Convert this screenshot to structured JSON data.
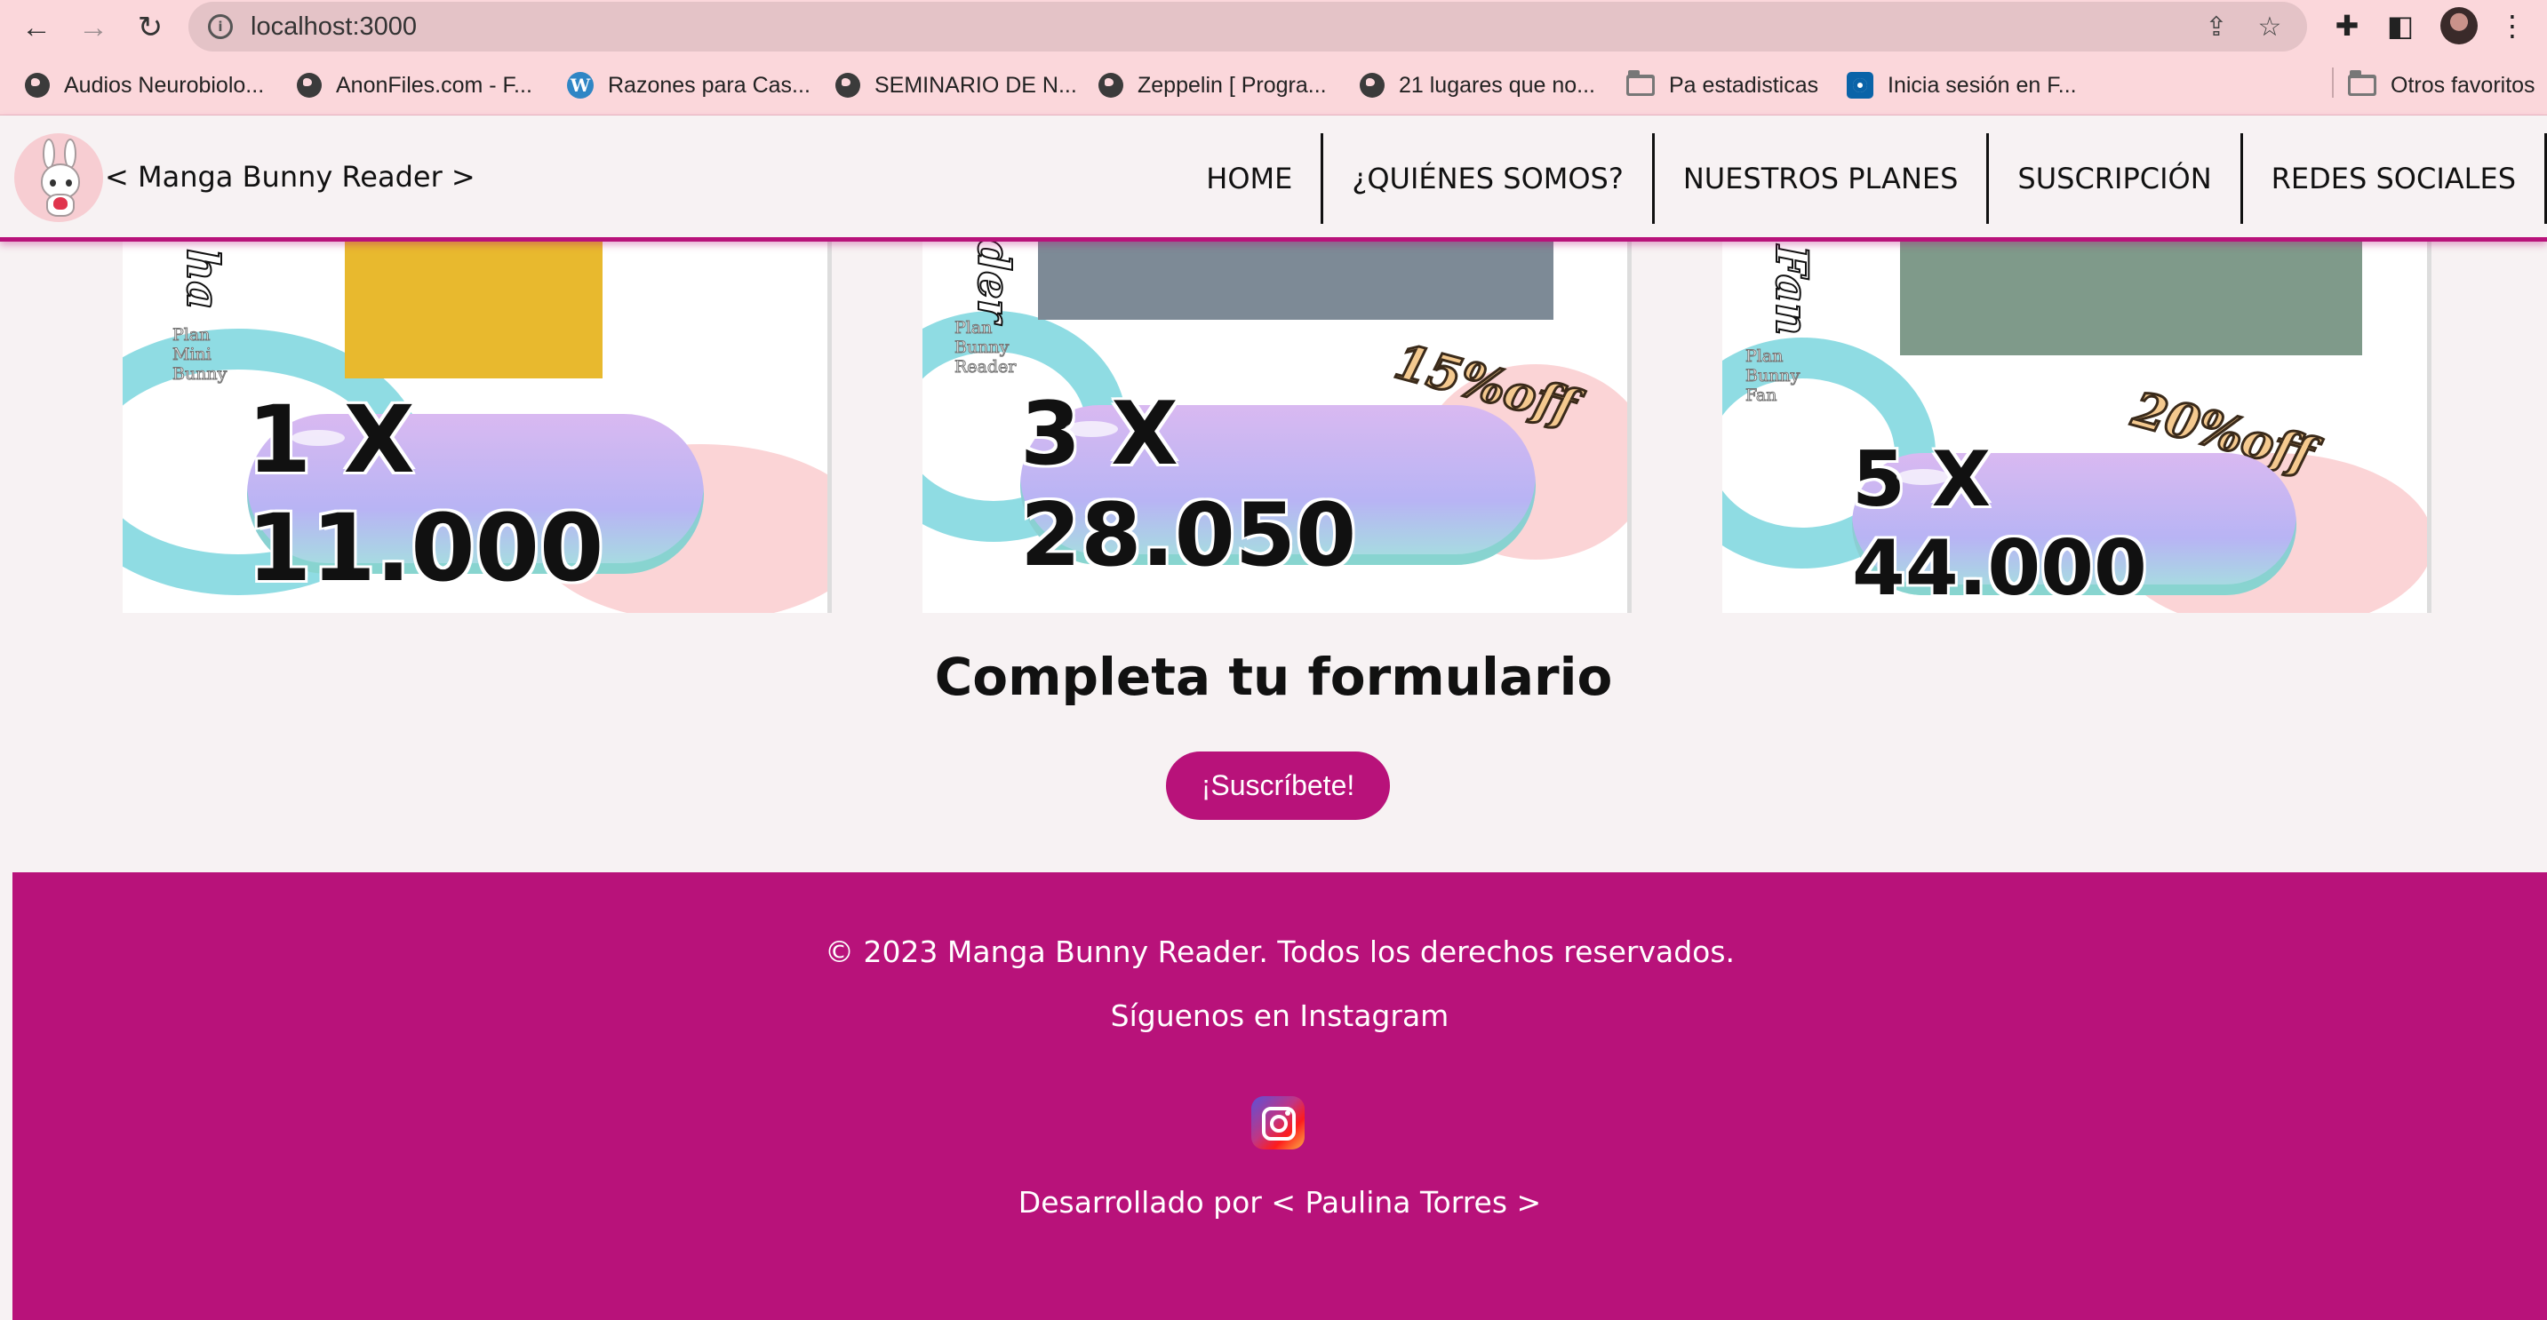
{
  "browser": {
    "url": "localhost:3000",
    "bookmarks": [
      {
        "label": "Audios Neurobiolo...",
        "icon": "globe-icon"
      },
      {
        "label": "AnonFiles.com - F...",
        "icon": "globe-icon"
      },
      {
        "label": "Razones para Cas...",
        "icon": "wordpress-icon"
      },
      {
        "label": "SEMINARIO DE N...",
        "icon": "globe-icon"
      },
      {
        "label": "Zeppelin [ Progra...",
        "icon": "globe-icon"
      },
      {
        "label": "21 lugares que no...",
        "icon": "globe-icon"
      },
      {
        "label": "Pa estadisticas",
        "icon": "folder-icon"
      },
      {
        "label": "Inicia sesión en F...",
        "icon": "site-icon"
      },
      {
        "label": "Otros favoritos",
        "icon": "folder-icon"
      }
    ]
  },
  "header": {
    "brand": "< Manga Bunny Reader >",
    "nav": [
      "HOME",
      "¿QUIÉNES SOMOS?",
      "NUESTROS PLANES",
      "SUSCRIPCIÓN",
      "REDES SOCIALES"
    ]
  },
  "plans": [
    {
      "tag": "Plan Mini Bunny",
      "price": "1 X 11.000",
      "discount": ""
    },
    {
      "tag": "Plan Bunny Reader",
      "price": "3 X 28.050",
      "discount": "15%off"
    },
    {
      "tag": "Plan Bunny Fan",
      "price": "5 X 44.000",
      "discount": "20%off"
    }
  ],
  "form": {
    "title": "Completa tu formulario",
    "button": "¡Suscríbete!"
  },
  "footer": {
    "copyright": "© 2023 Manga Bunny Reader. Todos los derechos reservados.",
    "follow": "Síguenos en Instagram",
    "developer": "Desarrollado por < Paulina Torres >"
  },
  "colors": {
    "accent": "#b8127a",
    "browser_chrome": "#fbd7db",
    "page_bg": "#f7f2f3"
  }
}
